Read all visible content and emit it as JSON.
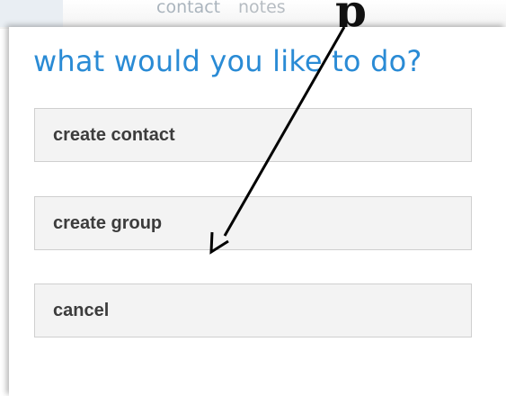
{
  "header": {
    "tabs": [
      {
        "label": "contact"
      },
      {
        "label": "notes"
      }
    ],
    "caption_fragment": "p"
  },
  "dialog": {
    "title": "what would you like to do?",
    "options": [
      {
        "label": "create contact"
      },
      {
        "label": "create group"
      },
      {
        "label": "cancel"
      }
    ]
  },
  "annotation": {
    "arrow_color": "#000000",
    "points_to": "create group"
  },
  "colors": {
    "title": "#2a8bd5",
    "option_bg": "#f3f3f3",
    "option_border": "#cfcfcf"
  }
}
